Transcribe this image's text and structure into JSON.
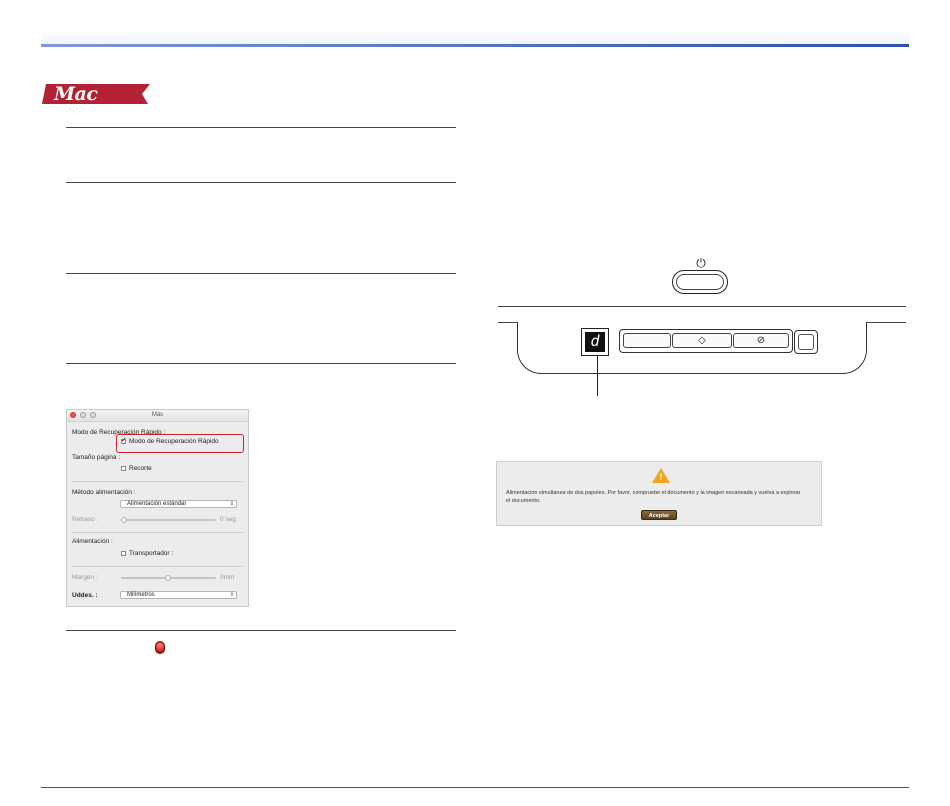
{
  "header": {
    "accent": "#2d4fb0"
  },
  "mac_badge": {
    "label": "Mac",
    "color": "#b22234"
  },
  "mac_dialog": {
    "title": "Más",
    "fast_recovery_section": "Modo de Recuperación Rápido :",
    "fast_recovery_checkbox": "Modo de Recuperación Rápido",
    "fast_recovery_checked": true,
    "page_size_section": "Tamaño página :",
    "crop_checkbox": "Recorte",
    "crop_checked": false,
    "feed_method_section": "Método alimentación :",
    "feed_method_value": "Alimentación estándar",
    "delay_label": "Retraso :",
    "delay_value": "0 seg",
    "feeding_section": "Alimentación :",
    "carrier_checkbox": "Transportador :",
    "carrier_checked": false,
    "margin_label": "Margen :",
    "margin_value": "0mm",
    "units_label": "Uddes. :",
    "units_value": "Milímetros",
    "highlight_color": "#d2232a"
  },
  "scanner": {
    "counter_digit": "d",
    "icons": [
      "power-icon",
      "start-icon",
      "stop-icon"
    ]
  },
  "alert": {
    "icon": "warning-icon",
    "message": "Alimentacion simultanea de dos papeles. Por favor, compruebe el documento y la imagen escaneada y vuelva a explorar el documento.",
    "button": "Aceptar"
  }
}
